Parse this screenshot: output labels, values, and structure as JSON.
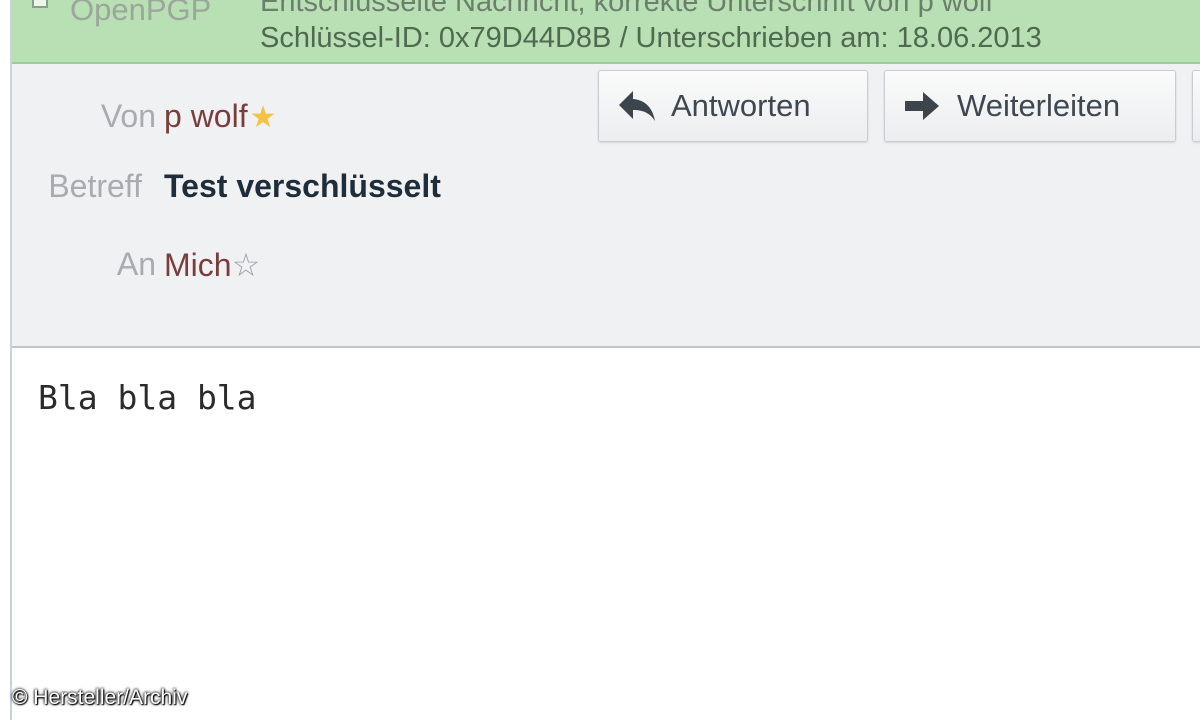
{
  "pgp": {
    "label": "OpenPGP",
    "status_text": "Entschlüsselte Nachricht, korrekte Unterschrift von p wolf",
    "key_info": "Schlüssel-ID: 0x79D44D8B / Unterschrieben am: 18.06.2013"
  },
  "header": {
    "from_label": "Von",
    "from_value": "p wolf",
    "subject_label": "Betreff",
    "subject_value": "Test verschlüsselt",
    "to_label": "An",
    "to_value": "Mich"
  },
  "actions": {
    "reply_label": "Antworten",
    "forward_label": "Weiterleiten"
  },
  "body": {
    "text": "Bla bla bla"
  },
  "watermark": "© Hersteller/Archiv",
  "colors": {
    "pgp_banner": "#b9dfb5",
    "header_bg": "#f0f1f2",
    "contact_star": "#f3c443"
  }
}
